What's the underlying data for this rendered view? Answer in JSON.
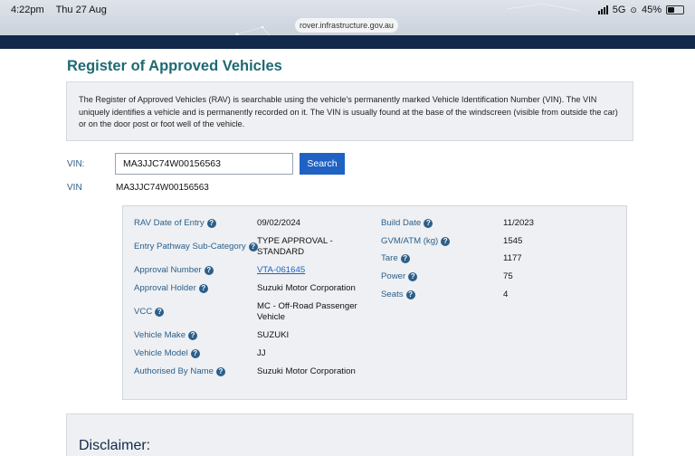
{
  "status_bar": {
    "time": "4:22pm",
    "date": "Thu 27 Aug",
    "network": "5G",
    "battery": "45%",
    "battery_level": 0.45
  },
  "browser": {
    "url": "rover.infrastructure.gov.au"
  },
  "page": {
    "title": "Register of Approved Vehicles",
    "intro": "The Register of Approved Vehicles (RAV) is searchable using the vehicle's permanently marked Vehicle Identification Number (VIN). The VIN uniquely identifies a vehicle and is permanently recorded on it. The VIN is usually found at the base of the windscreen (visible from outside the car) or on the door post or foot well of the vehicle.",
    "search": {
      "label": "VIN:",
      "value": "MA3JJC74W00156563",
      "button_label": "Search"
    },
    "result_vin": {
      "label": "VIN",
      "value": "MA3JJC74W00156563"
    }
  },
  "details": {
    "left": [
      {
        "label": "RAV Date of Entry",
        "value": "09/02/2024"
      },
      {
        "label": "Entry Pathway Sub-Category",
        "value": "TYPE APPROVAL - STANDARD"
      },
      {
        "label": "Approval Number",
        "value": "VTA-061645"
      },
      {
        "label": "Approval Holder",
        "value": "Suzuki Motor Corporation"
      },
      {
        "label": "VCC",
        "value": "MC - Off-Road Passenger Vehicle"
      },
      {
        "label": "Vehicle Make",
        "value": "SUZUKI"
      },
      {
        "label": "Vehicle Model",
        "value": "JJ"
      },
      {
        "label": "Authorised By Name",
        "value": "Suzuki Motor Corporation"
      }
    ],
    "right": [
      {
        "label": "Build Date",
        "value": "11/2023"
      },
      {
        "label": "GVM/ATM (kg)",
        "value": "1545"
      },
      {
        "label": "Tare",
        "value": "1177"
      },
      {
        "label": "Power",
        "value": "75"
      },
      {
        "label": "Seats",
        "value": "4"
      }
    ]
  },
  "disclaimer": {
    "title": "Disclaimer:"
  },
  "icons": {
    "help": "help-circle-icon",
    "signal": "signal-bars-icon",
    "battery": "battery-icon",
    "location": "location-arrow-icon"
  },
  "colors": {
    "title": "#1e6a73",
    "label": "#2b5f8a",
    "button": "#1f62c4",
    "navbar": "#13294b",
    "panel": "#eef0f3"
  }
}
